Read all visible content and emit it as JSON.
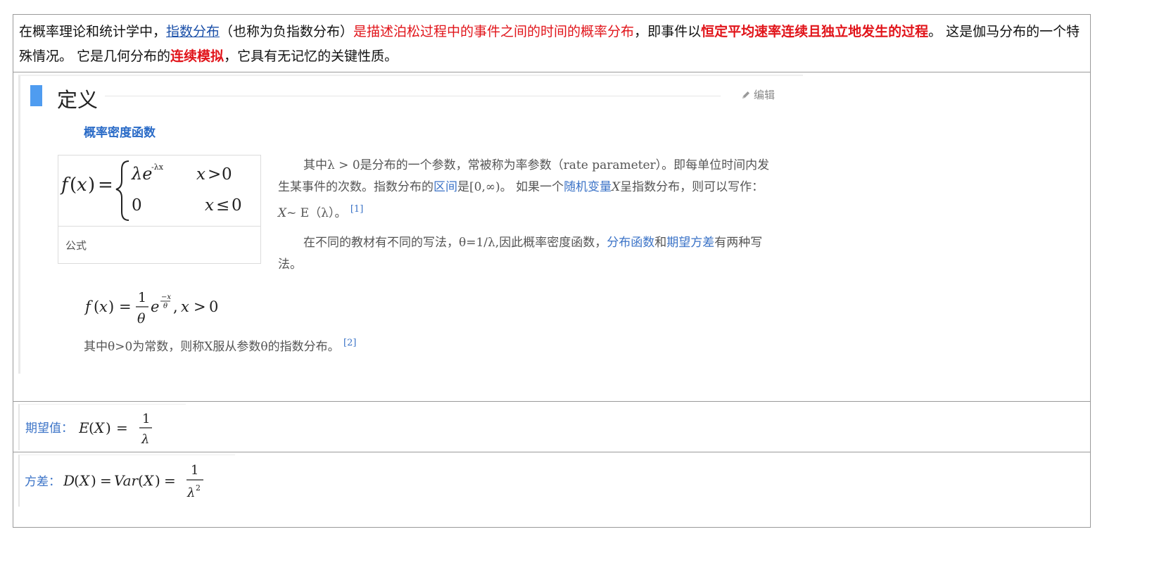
{
  "intro": {
    "p1": "在概率理论和统计学中，",
    "link": "指数分布",
    "p2": "（也称为负指数分布）",
    "red1": "是描述泊松过程中的事件之间的时间的概率分布",
    "p3": "，即事件以",
    "red2": "恒定平均速率连续且独立地发生的过程",
    "p4": "。 这是伽马分布的一个特殊情况。 它是几何分布的",
    "red3": "连续模拟",
    "p5": "，它具有无记忆的关键性质。"
  },
  "section": {
    "title": "定义",
    "edit": "编辑",
    "subheading": "概率密度函数",
    "formula_caption": "公式",
    "para1": {
      "a": "其中λ > 0是分布的一个参数，常被称为率参数（rate parameter）。即每单位时间内发生某事件的次数。指数分布的",
      "link1": "区间",
      "b": "是[0,∞)。 如果一个",
      "link2": "随机变量",
      "c": "X",
      "d": "呈指数分布，则可以写作：",
      "e": "X",
      "f": "~ E（λ）。",
      "ref": "[1]"
    },
    "para2": {
      "a": "在不同的教材有不同的写法，θ=1/λ,因此概率密度函数，",
      "link1": "分布函数",
      "b": "和",
      "link2": "期望方差",
      "c": "有两种写法。"
    },
    "para3": {
      "text": "其中θ>0为常数，则称X服从参数θ的指数分布。",
      "ref": "[2]"
    }
  },
  "expectation": {
    "label": "期望值："
  },
  "variance": {
    "label": "方差："
  }
}
